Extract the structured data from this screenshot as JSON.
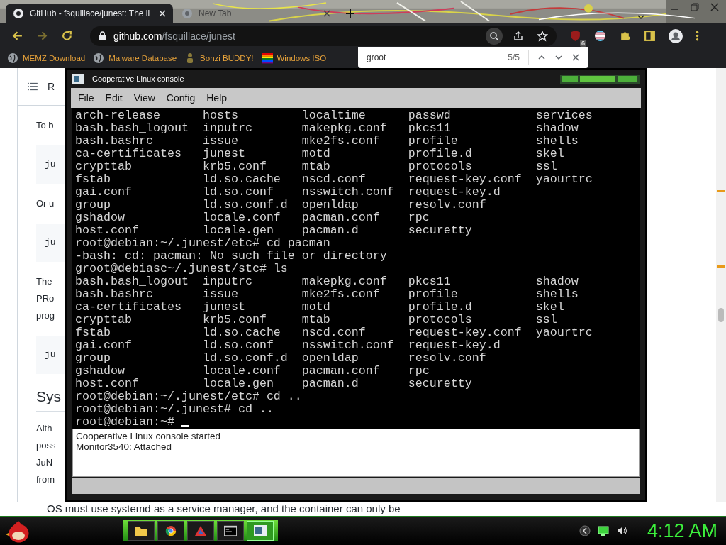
{
  "browser": {
    "tabs": [
      {
        "title": "GitHub - fsquillace/junest: The li",
        "selected": true
      },
      {
        "title": "New Tab",
        "selected": false
      }
    ],
    "url": {
      "host": "github.com",
      "path": "/fsquillace/junest"
    },
    "extension_badge": "6",
    "bookmarks": [
      {
        "label": "MEMZ Download",
        "kind": "globe"
      },
      {
        "label": "Malware Database",
        "kind": "globe"
      },
      {
        "label": "Bonzi BUDDY!",
        "kind": "figure"
      },
      {
        "label": "Windows ISO",
        "kind": "flag"
      }
    ],
    "find_bar": {
      "value": "groot",
      "count": "5/5"
    }
  },
  "page": {
    "toc_label": "R",
    "blocks": [
      {
        "kind": "para",
        "lines": [
          "To b"
        ]
      },
      {
        "kind": "code",
        "lines": [
          "ju"
        ]
      },
      {
        "kind": "para",
        "lines": [
          "Or u"
        ]
      },
      {
        "kind": "code",
        "lines": [
          "ju"
        ]
      },
      {
        "kind": "para",
        "lines": [
          "The",
          "PRo",
          "prog"
        ]
      },
      {
        "kind": "code",
        "lines": [
          "ju"
        ]
      },
      {
        "kind": "heading",
        "lines": [
          "Sys"
        ]
      },
      {
        "kind": "para",
        "lines": [
          "Alth",
          "poss",
          "JuN",
          "from"
        ]
      }
    ],
    "bottom_line": "OS must use systemd as a service manager, and the container can only be"
  },
  "console": {
    "title": "Cooperative Linux console",
    "menu": [
      "File",
      "Edit",
      "View",
      "Config",
      "Help"
    ],
    "lines": [
      [
        "arch-release",
        "hosts",
        "localtime",
        "passwd",
        "services"
      ],
      [
        "bash.bash_logout",
        "inputrc",
        "makepkg.conf",
        "pkcs11",
        "shadow"
      ],
      [
        "bash.bashrc",
        "issue",
        "mke2fs.conf",
        "profile",
        "shells"
      ],
      [
        "ca-certificates",
        "junest",
        "motd",
        "profile.d",
        "skel"
      ],
      [
        "crypttab",
        "krb5.conf",
        "mtab",
        "protocols",
        "ssl"
      ],
      [
        "fstab",
        "ld.so.cache",
        "nscd.conf",
        "request-key.conf",
        "yaourtrc"
      ],
      [
        "gai.conf",
        "ld.so.conf",
        "nsswitch.conf",
        "request-key.d"
      ],
      [
        "group",
        "ld.so.conf.d",
        "openldap",
        "resolv.conf"
      ],
      [
        "gshadow",
        "locale.conf",
        "pacman.conf",
        "rpc"
      ],
      [
        "host.conf",
        "locale.gen",
        "pacman.d",
        "securetty"
      ],
      [
        "root@debian:~/.junest/etc# cd pacman"
      ],
      [
        "-bash: cd: pacman: No such file or directory"
      ],
      [
        "groot@debiasc~/.junest/stc# ls"
      ],
      [
        "bash.bash_logout",
        "inputrc",
        "makepkg.conf",
        "pkcs11",
        "shadow"
      ],
      [
        "bash.bashrc",
        "issue",
        "mke2fs.conf",
        "profile",
        "shells"
      ],
      [
        "ca-certificates",
        "junest",
        "motd",
        "profile.d",
        "skel"
      ],
      [
        "crypttab",
        "krb5.conf",
        "mtab",
        "protocols",
        "ssl"
      ],
      [
        "fstab",
        "ld.so.cache",
        "nscd.conf",
        "request-key.conf",
        "yaourtrc"
      ],
      [
        "gai.conf",
        "ld.so.conf",
        "nsswitch.conf",
        "request-key.d"
      ],
      [
        "group",
        "ld.so.conf.d",
        "openldap",
        "resolv.conf"
      ],
      [
        "gshadow",
        "locale.conf",
        "pacman.conf",
        "rpc"
      ],
      [
        "host.conf",
        "locale.gen",
        "pacman.d",
        "securetty"
      ],
      [
        "root@debian:~/.junest/etc# cd .."
      ],
      [
        "root@debian:~/.junest# cd .."
      ],
      [
        "root@debian:~# "
      ]
    ],
    "cursor_visible": true,
    "log": [
      "Cooperative Linux console started",
      "Monitor3540: Attached"
    ]
  },
  "taskbar": {
    "apps": [
      {
        "kind": "folder",
        "selected": false
      },
      {
        "kind": "browser",
        "selected": false
      },
      {
        "kind": "triangle",
        "selected": false
      },
      {
        "kind": "terminal",
        "selected": false
      },
      {
        "kind": "console",
        "selected": true
      }
    ],
    "clock": "4:12 AM"
  }
}
